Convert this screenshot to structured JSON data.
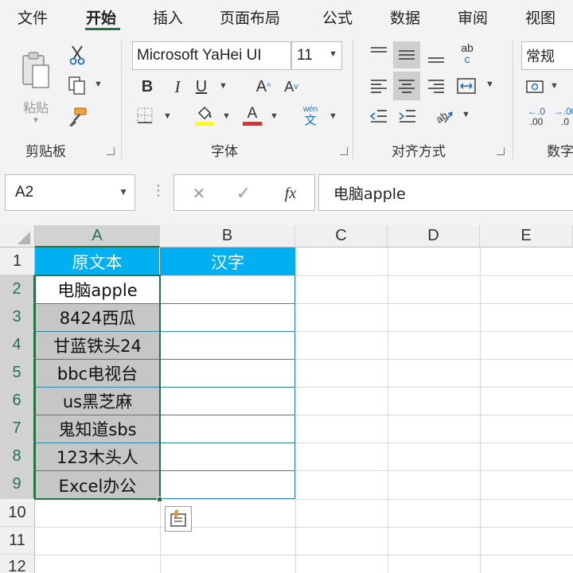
{
  "tabs": [
    "文件",
    "开始",
    "插入",
    "页面布局",
    "公式",
    "数据",
    "审阅",
    "视图"
  ],
  "clipboard": {
    "paste_label": "粘贴",
    "group_label": "剪贴板"
  },
  "font": {
    "name": "Microsoft YaHei UI",
    "size": "11",
    "bold": "B",
    "italic": "I",
    "underline": "U",
    "grow": "A",
    "shrink": "A",
    "phonetic_top": "wén",
    "phonetic_bottom": "文",
    "color_letter": "A",
    "group_label": "字体"
  },
  "alignment": {
    "group_label": "对齐方式",
    "wrap_top": "ab",
    "wrap_bottom": "c"
  },
  "number": {
    "format": "常规",
    "group_label": "数字",
    "inc_top": "←.0",
    "inc_bottom": ".00",
    "dec_top": "→.00",
    "dec_bottom": ".0"
  },
  "formula_bar": {
    "name_box": "A2",
    "fx": "fx",
    "cancel": "✕",
    "confirm": "✓",
    "content": "电脑apple"
  },
  "columns": [
    "A",
    "B",
    "C",
    "D",
    "E"
  ],
  "rows": [
    "1",
    "2",
    "3",
    "4",
    "5",
    "6",
    "7",
    "8",
    "9",
    "10",
    "11",
    "12"
  ],
  "headers": {
    "a1": "原文本",
    "b1": "汉字"
  },
  "cells": [
    "电脑apple",
    "8424西瓜",
    "甘蓝铁头24",
    "bbc电视台",
    "us黑芝麻",
    "鬼知道sbs",
    "123木头人",
    "Excel办公"
  ],
  "colors": {
    "accent": "#217346",
    "header_fill": "#00b0f0",
    "selection_fill": "#c6c6c6",
    "table_border": "#2e86a8",
    "font_color": "#e03030",
    "highlight": "#ffff00"
  }
}
